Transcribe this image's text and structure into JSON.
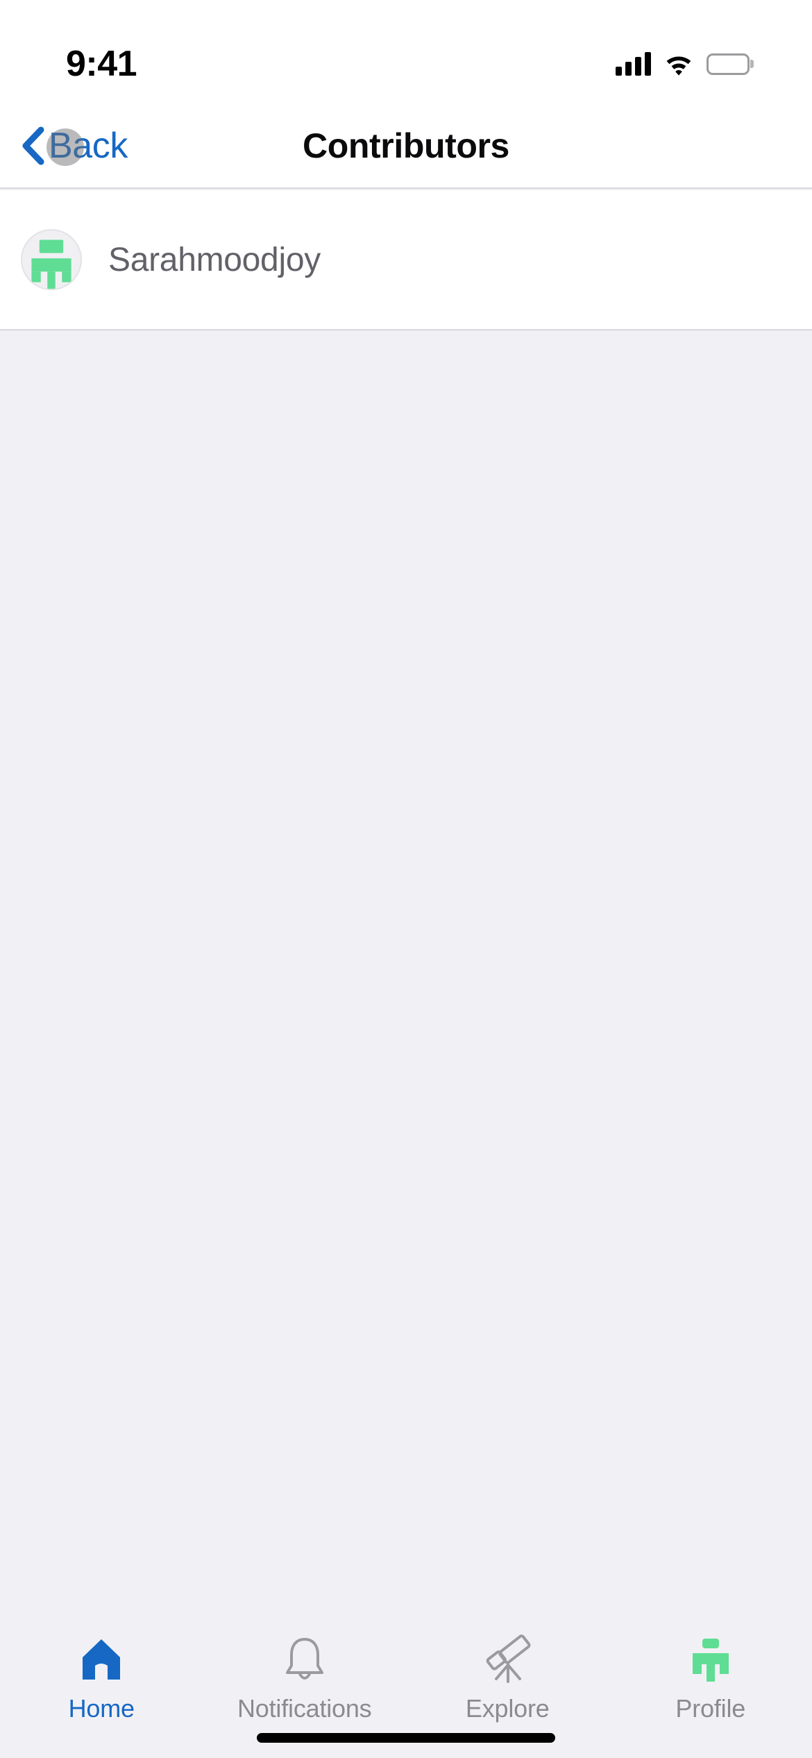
{
  "status_bar": {
    "time": "9:41",
    "icons": [
      "cellular-signal-icon",
      "wifi-icon",
      "battery-icon"
    ]
  },
  "nav_bar": {
    "back_label": "Back",
    "back_icon": "chevron-left-icon",
    "title": "Contributors"
  },
  "contributors": {
    "items": [
      {
        "name": "Sarahmoodjoy",
        "avatar_icon": "brand-logo-avatar"
      }
    ]
  },
  "tab_bar": {
    "tabs": [
      {
        "label": "Home",
        "icon": "home-icon",
        "active": true
      },
      {
        "label": "Notifications",
        "icon": "bell-icon",
        "active": false
      },
      {
        "label": "Explore",
        "icon": "telescope-icon",
        "active": false
      },
      {
        "label": "Profile",
        "icon": "brand-logo-icon",
        "active": false
      }
    ]
  },
  "colors": {
    "accent_blue": "#1668c4",
    "brand_green": "#5fdd94",
    "inactive_gray": "#8a8a8f",
    "page_background": "#f1f1f5",
    "card_background": "#ffffff",
    "separator": "#d8d8dc"
  }
}
